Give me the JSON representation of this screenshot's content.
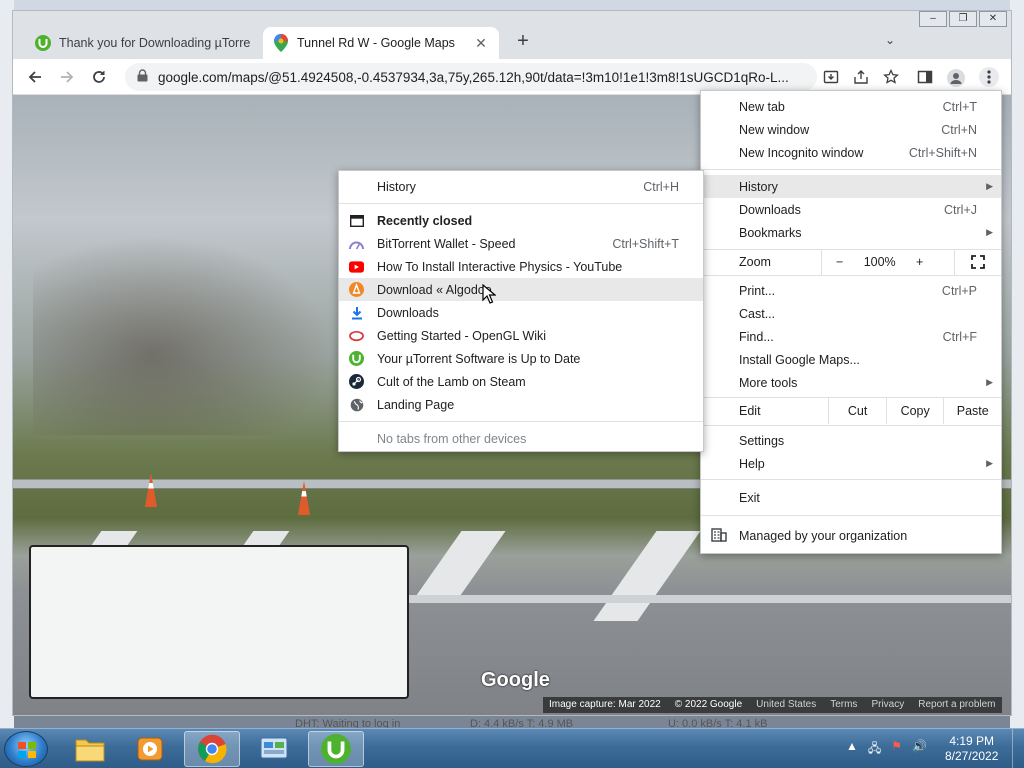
{
  "browser": {
    "tabs": [
      {
        "title": "Thank you for Downloading µTorrent",
        "active": false
      },
      {
        "title": "Tunnel Rd W - Google Maps",
        "active": true
      }
    ],
    "url": "google.com/maps/@51.4924508,-0.4537934,3a,75y,265.12h,90t/data=!3m10!1e1!3m8!1sUGCD1qRo-L...",
    "window_controls": {
      "minimize": "‒",
      "restore": "❐",
      "close": "✕"
    },
    "new_tab_symbol": "+",
    "tab_search_symbol": "⌄"
  },
  "streetview": {
    "logo": "Google",
    "footer": {
      "capture": "Image capture: Mar 2022",
      "copyright": "© 2022 Google",
      "region": "United States",
      "terms": "Terms",
      "privacy": "Privacy",
      "report": "Report a problem"
    }
  },
  "menu": {
    "new_tab": {
      "label": "New tab",
      "shortcut": "Ctrl+T"
    },
    "new_window": {
      "label": "New window",
      "shortcut": "Ctrl+N"
    },
    "new_incognito": {
      "label": "New Incognito window",
      "shortcut": "Ctrl+Shift+N"
    },
    "history": {
      "label": "History"
    },
    "downloads": {
      "label": "Downloads",
      "shortcut": "Ctrl+J"
    },
    "bookmarks": {
      "label": "Bookmarks"
    },
    "zoom": {
      "label": "Zoom",
      "minus": "−",
      "value": "100%",
      "plus": "+"
    },
    "print": {
      "label": "Print...",
      "shortcut": "Ctrl+P"
    },
    "cast": {
      "label": "Cast..."
    },
    "find": {
      "label": "Find...",
      "shortcut": "Ctrl+F"
    },
    "install": {
      "label": "Install Google Maps..."
    },
    "more_tools": {
      "label": "More tools"
    },
    "edit": {
      "label": "Edit",
      "cut": "Cut",
      "copy": "Copy",
      "paste": "Paste"
    },
    "settings": {
      "label": "Settings"
    },
    "help": {
      "label": "Help"
    },
    "exit": {
      "label": "Exit"
    },
    "managed": {
      "label": "Managed by your organization"
    }
  },
  "history_menu": {
    "history": {
      "label": "History",
      "shortcut": "Ctrl+H"
    },
    "recently_closed": "Recently closed",
    "items": [
      {
        "label": "BitTorrent Wallet - Speed",
        "shortcut": "Ctrl+Shift+T",
        "icon": "bittorrent-speed-icon",
        "color": "#8a7fd0"
      },
      {
        "label": "How To Install Interactive Physics - YouTube",
        "shortcut": "",
        "icon": "youtube-icon",
        "color": "#ff0000"
      },
      {
        "label": "Download « Algodoo",
        "shortcut": "",
        "icon": "algodoo-icon",
        "color": "#f0882a"
      },
      {
        "label": "Downloads",
        "shortcut": "",
        "icon": "download-icon",
        "color": "#1a73e8"
      },
      {
        "label": "Getting Started - OpenGL Wiki",
        "shortcut": "",
        "icon": "opengl-icon",
        "color": "#d9363e"
      },
      {
        "label": "Your µTorrent Software is Up to Date",
        "shortcut": "",
        "icon": "utorrent-icon",
        "color": "#4db22e"
      },
      {
        "label": "Cult of the Lamb on Steam",
        "shortcut": "",
        "icon": "steam-icon",
        "color": "#1b2838"
      },
      {
        "label": "Landing Page",
        "shortcut": "",
        "icon": "globe-icon",
        "color": "#5f6368"
      }
    ],
    "no_tabs": "No tabs from other devices"
  },
  "background_status": {
    "dht": "DHT: Waiting to log in",
    "down": "D: 4.4 kB/s T: 4.9 MB",
    "up": "U: 0.0 kB/s T: 4.1 kB"
  },
  "taskbar": {
    "time": "4:19 PM",
    "date": "8/27/2022",
    "apps": [
      "explorer",
      "media-player",
      "chrome",
      "control-panel",
      "utorrent"
    ]
  }
}
